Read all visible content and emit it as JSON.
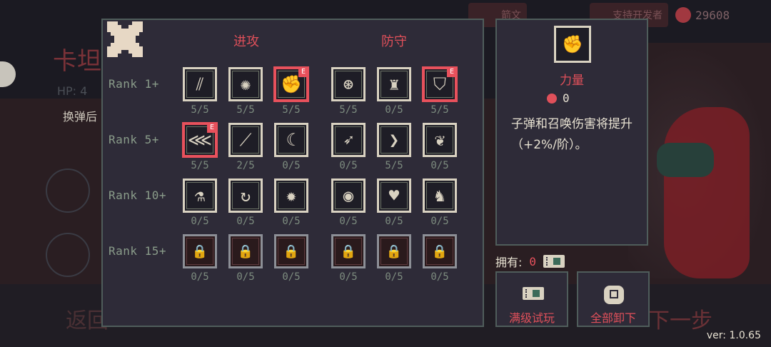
{
  "background": {
    "character_name": "卡坦",
    "hp_label": "HP: 4",
    "desc": "换弹后",
    "back_label": "返回",
    "next_label": "下一步",
    "topbar": {
      "item1": "箭文",
      "item2": "支持开发者",
      "currency": "29608"
    }
  },
  "close_icon": "close-x-icon",
  "columns": {
    "attack": "进攻",
    "defense": "防守"
  },
  "ranks": [
    {
      "label": "Rank 1+",
      "skills": [
        {
          "icon": "slash-lines-icon",
          "glyph": "⫽",
          "level": "5/5",
          "selected": false,
          "equipped": false,
          "locked": false
        },
        {
          "icon": "vortex-icon",
          "glyph": "✺",
          "level": "5/5",
          "selected": false,
          "equipped": false,
          "locked": false
        },
        {
          "icon": "fist-icon",
          "glyph": "✊",
          "level": "5/5",
          "selected": true,
          "equipped": true,
          "locked": false
        },
        {
          "icon": "arcane-circle-icon",
          "glyph": "⊛",
          "level": "5/5",
          "selected": false,
          "equipped": false,
          "locked": false
        },
        {
          "icon": "flex-figure-icon",
          "glyph": "♜",
          "level": "0/5",
          "selected": false,
          "equipped": false,
          "locked": false
        },
        {
          "icon": "shield-icon",
          "glyph": "⛉",
          "level": "5/5",
          "selected": true,
          "equipped": true,
          "locked": false
        }
      ]
    },
    {
      "label": "Rank 5+",
      "skills": [
        {
          "icon": "triple-arrow-icon",
          "glyph": "⋘",
          "level": "5/5",
          "selected": true,
          "equipped": true,
          "locked": false
        },
        {
          "icon": "claw-slash-icon",
          "glyph": "⟋",
          "level": "2/5",
          "selected": false,
          "equipped": false,
          "locked": false
        },
        {
          "icon": "crescent-slash-icon",
          "glyph": "☾",
          "level": "0/5",
          "selected": false,
          "equipped": false,
          "locked": false
        },
        {
          "icon": "dash-figure-icon",
          "glyph": "➶",
          "level": "0/5",
          "selected": false,
          "equipped": false,
          "locked": false
        },
        {
          "icon": "chevron-right-icon",
          "glyph": "❯",
          "level": "5/5",
          "selected": false,
          "equipped": false,
          "locked": false
        },
        {
          "icon": "leaf-icon",
          "glyph": "❦",
          "level": "0/5",
          "selected": false,
          "equipped": false,
          "locked": false
        }
      ]
    },
    {
      "label": "Rank 10+",
      "skills": [
        {
          "icon": "potion-icon",
          "glyph": "⚗",
          "level": "0/5",
          "selected": false,
          "equipped": false,
          "locked": false
        },
        {
          "icon": "reload-hand-icon",
          "glyph": "↻",
          "level": "0/5",
          "selected": false,
          "equipped": false,
          "locked": false
        },
        {
          "icon": "burst-icon",
          "glyph": "✹",
          "level": "0/5",
          "selected": false,
          "equipped": false,
          "locked": false
        },
        {
          "icon": "orb-icon",
          "glyph": "◉",
          "level": "0/5",
          "selected": false,
          "equipped": false,
          "locked": false
        },
        {
          "icon": "hearts-icon",
          "glyph": "♥",
          "level": "0/5",
          "selected": false,
          "equipped": false,
          "locked": false
        },
        {
          "icon": "running-figure-icon",
          "glyph": "♞",
          "level": "0/5",
          "selected": false,
          "equipped": false,
          "locked": false
        }
      ]
    },
    {
      "label": "Rank 15+",
      "skills": [
        {
          "icon": "locked-skill-icon",
          "glyph": "🔒",
          "level": "0/5",
          "selected": false,
          "equipped": false,
          "locked": true
        },
        {
          "icon": "locked-skill-icon",
          "glyph": "🔒",
          "level": "0/5",
          "selected": false,
          "equipped": false,
          "locked": true
        },
        {
          "icon": "locked-skill-icon",
          "glyph": "🔒",
          "level": "0/5",
          "selected": false,
          "equipped": false,
          "locked": true
        },
        {
          "icon": "locked-skill-icon",
          "glyph": "🔒",
          "level": "0/5",
          "selected": false,
          "equipped": false,
          "locked": true
        },
        {
          "icon": "locked-skill-icon",
          "glyph": "🔒",
          "level": "0/5",
          "selected": false,
          "equipped": false,
          "locked": true
        },
        {
          "icon": "locked-skill-icon",
          "glyph": "🔒",
          "level": "0/5",
          "selected": false,
          "equipped": false,
          "locked": true
        }
      ]
    }
  ],
  "equipped_badge": "E",
  "detail": {
    "icon": "fist-icon",
    "glyph": "✊",
    "name": "力量",
    "cost": "0",
    "description": "子弹和召唤伤害将提升（+2%/阶）。"
  },
  "owned": {
    "label": "拥有:",
    "count": "0",
    "ticket_icon": "ticket-icon"
  },
  "buttons": {
    "max_trial": "满级试玩",
    "unequip_all": "全部卸下"
  },
  "version": "ver: 1.0.65",
  "colors": {
    "accent": "#e0505a",
    "panel_bg": "#2e2b38",
    "panel_border": "#4f5d5b",
    "icon_frame": "#d9d2c1",
    "level_text": "#7d8c7f"
  }
}
